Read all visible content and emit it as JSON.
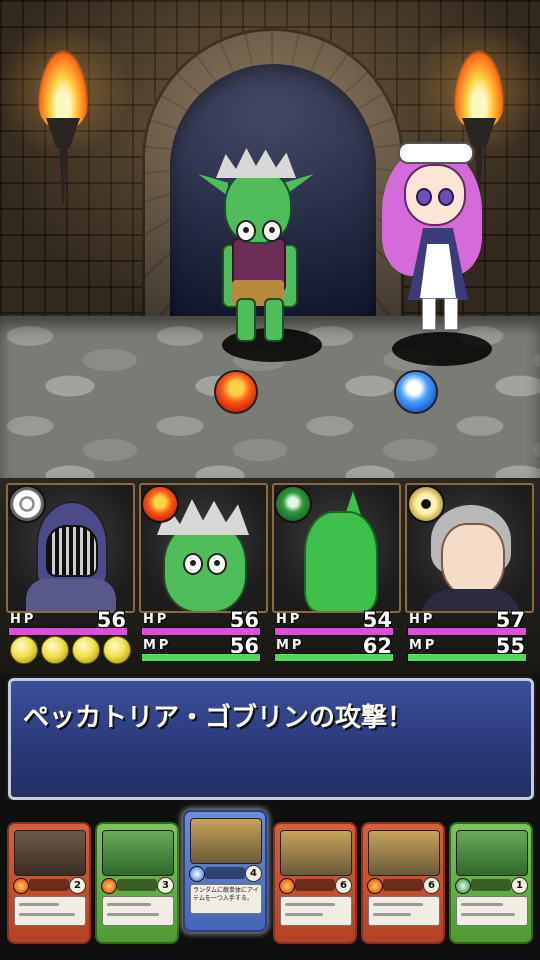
{
  "battle": {
    "enemy_left": {
      "name": "goblin",
      "element": "fire-icon"
    },
    "enemy_right": {
      "name": "maid",
      "element": "water-icon"
    }
  },
  "party": {
    "members": [
      {
        "element": "wind-icon",
        "hp_label": "HP",
        "hp": "56",
        "mp_label": "",
        "mp": "",
        "hp_fill": 1.0
      },
      {
        "element": "fire-icon",
        "hp_label": "HP",
        "hp": "56",
        "mp_label": "MP",
        "mp": "56",
        "hp_fill": 1.0,
        "mp_fill": 1.0
      },
      {
        "element": "earth-icon",
        "hp_label": "HP",
        "hp": "54",
        "mp_label": "MP",
        "mp": "62",
        "hp_fill": 1.0,
        "mp_fill": 1.0
      },
      {
        "element": "light-icon",
        "hp_label": "HP",
        "hp": "57",
        "mp_label": "MP",
        "mp": "55",
        "hp_fill": 1.0,
        "mp_fill": 1.0
      }
    ],
    "energy_count": 4
  },
  "message": {
    "text": "ペッカトリア・ゴブリンの攻撃！"
  },
  "hand": {
    "cards": [
      {
        "element": "fire",
        "cost": "2",
        "selected": false,
        "desc": ""
      },
      {
        "element": "fire",
        "cost": "3",
        "selected": false,
        "desc": ""
      },
      {
        "element": "water",
        "cost": "4",
        "selected": true,
        "desc": "ランダムに敵単体にアイテムを一つ入手する。"
      },
      {
        "element": "fire",
        "cost": "6",
        "selected": false,
        "desc": ""
      },
      {
        "element": "fire",
        "cost": "6",
        "selected": false,
        "desc": ""
      },
      {
        "element": "earth",
        "cost": "1",
        "selected": false,
        "desc": ""
      }
    ]
  },
  "colors": {
    "hp_bar": "#e04ddc",
    "mp_bar": "#4ddc5a",
    "message_bg": "#2a3878"
  }
}
